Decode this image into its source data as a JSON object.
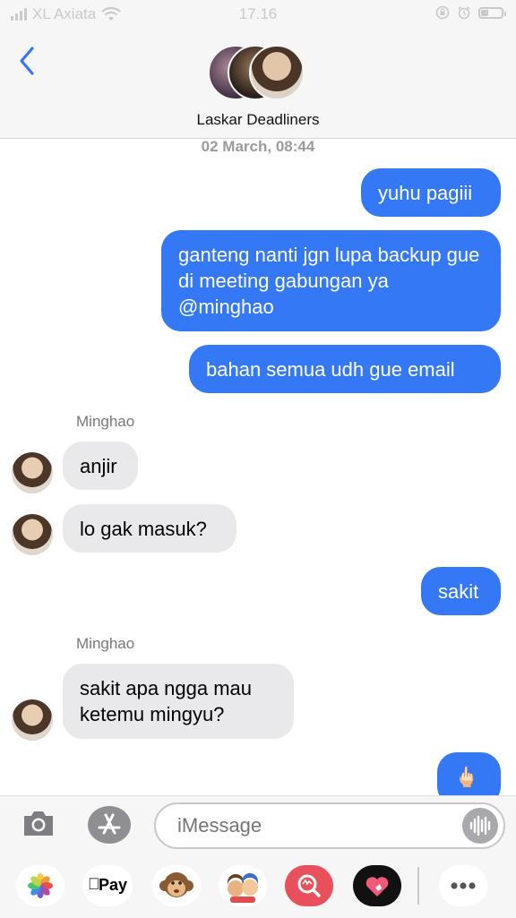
{
  "status_bar": {
    "carrier": "XL Axiata",
    "time": "17.16"
  },
  "header": {
    "back_icon": "chevron-left-icon",
    "group_name": "Laskar Deadliners"
  },
  "conversation": {
    "timestamp": "02 March, 08:44",
    "messages": [
      {
        "direction": "sent",
        "text": "yuhu pagiii"
      },
      {
        "direction": "sent",
        "text": "ganteng nanti jgn lupa backup gue di meeting gabungan ya @minghao"
      },
      {
        "direction": "sent",
        "text": "bahan semua udh gue email"
      },
      {
        "direction": "received",
        "sender": "Minghao",
        "text": "anjir"
      },
      {
        "direction": "received",
        "text": "lo gak masuk?"
      },
      {
        "direction": "sent",
        "text": "sakit"
      },
      {
        "direction": "received",
        "sender": "Minghao",
        "text": "sakit apa ngga mau ketemu mingyu?"
      },
      {
        "direction": "sent",
        "text": "🖕🏻"
      }
    ]
  },
  "input_bar": {
    "placeholder": "iMessage",
    "camera_icon": "camera-icon",
    "appstore_icon": "app-store-icon",
    "voice_icon": "audio-waveform-icon"
  },
  "app_drawer": {
    "items": [
      {
        "icon": "photos-icon"
      },
      {
        "icon": "apple-pay-icon",
        "label": "Pay"
      },
      {
        "icon": "monkey-animoji-icon"
      },
      {
        "icon": "memoji-icon"
      },
      {
        "icon": "image-search-icon"
      },
      {
        "icon": "digital-touch-heart-icon"
      },
      {
        "icon": "more-icon"
      }
    ]
  },
  "colors": {
    "sent_bubble": "#3478f6",
    "received_bubble": "#e9e9eb",
    "header_bg": "#f6f6f6"
  }
}
